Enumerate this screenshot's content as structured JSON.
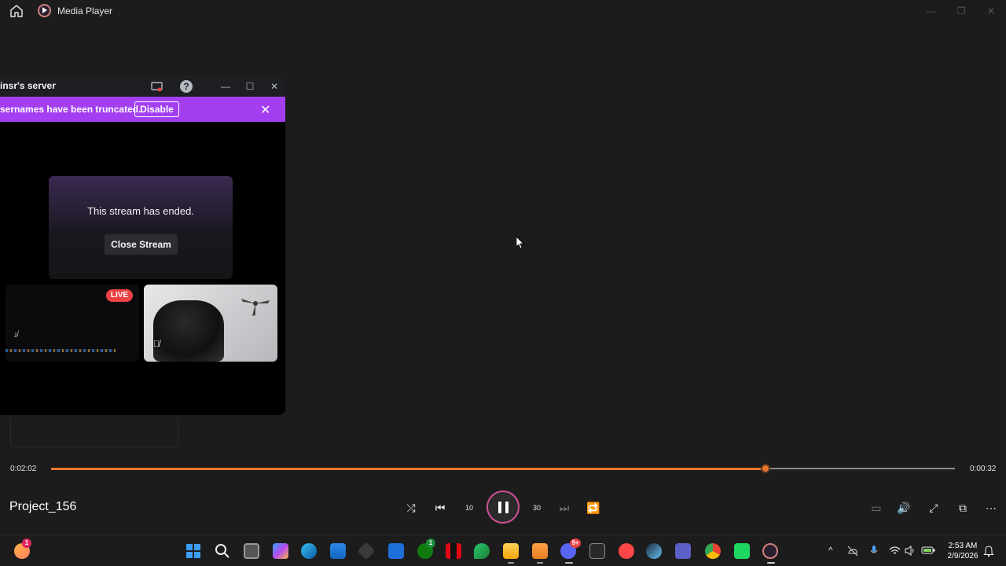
{
  "app": {
    "title": "Media Player",
    "home_icon": "home-icon",
    "app_icon": "media-player-icon"
  },
  "window_controls": {
    "minimize": "—",
    "maximize": "❐",
    "close": "✕"
  },
  "discord_popout": {
    "title": "insr's server",
    "icons": [
      "popout-screen-icon",
      "help-icon",
      "minimize-icon",
      "maximize-icon",
      "close-icon"
    ],
    "help_glyph": "?",
    "min_glyph": "—",
    "max_glyph": "☐",
    "close_glyph": "✕",
    "banner_text": "sernames have been truncated.",
    "banner_button": "Disable",
    "banner_close": "✕",
    "banner_color": "#a33ff0",
    "stream_ended_text": "This stream has ended.",
    "close_stream_label": "Close Stream",
    "tiles": [
      {
        "badge": "LIVE",
        "mute_glyph": "♪̸"
      },
      {
        "mute_glyph": "🎙̸"
      }
    ]
  },
  "player": {
    "elapsed": "0:02:02",
    "remaining": "0:00:32",
    "progress_fraction": 0.79,
    "media_title": "Project_156",
    "accent_color": "#e8742a",
    "controls": {
      "shuffle": "⤮",
      "previous": "⏮",
      "rewind": "⟲",
      "rewind_label": "10",
      "pause": "pause",
      "forward": "⟳",
      "forward_label": "30",
      "next": "⏭",
      "repeat": "🔁",
      "miniplayer": "▭",
      "volume": "🔊",
      "fullscreen": "⤢",
      "cast": "⧉",
      "more": "⋯"
    }
  },
  "taskbar": {
    "pinned": [
      "start-icon",
      "search-icon",
      "task-view-icon",
      "copilot-icon",
      "edge-icon",
      "store-icon",
      "app-icon",
      "code-icon",
      "xbox-icon",
      "netflix-icon",
      "vpn-icon",
      "file-explorer-icon",
      "fl-studio-icon",
      "discord-icon",
      "epic-games-icon",
      "ea-icon",
      "steam-icon",
      "teams-icon",
      "chrome-icon",
      "game-icon",
      "media-player-icon"
    ],
    "xbox_badge": "1",
    "discord_badge": "9+",
    "widgets_badge": "1",
    "tray": {
      "chevron": "^",
      "clock_time": "2:53 AM",
      "clock_date": "2/9/2026"
    }
  }
}
